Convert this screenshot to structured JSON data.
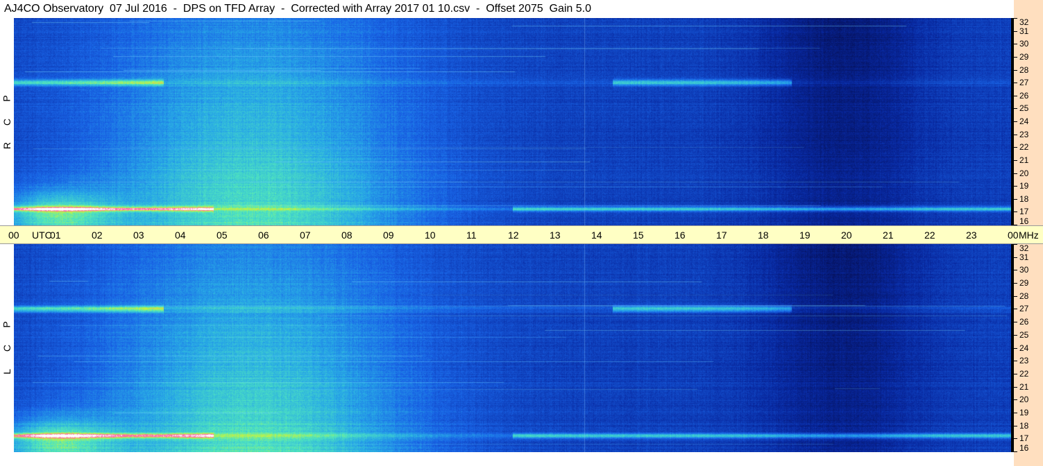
{
  "header": {
    "title": "AJ4CO Observatory  07 Jul 2016  -  DPS on TFD Array  -  Corrected with Array 2017 01 10.csv  -  Offset 2075  Gain 5.0"
  },
  "panels": [
    {
      "id": "rcp",
      "polarization_letters": [
        "R",
        "C",
        "P"
      ]
    },
    {
      "id": "lcp",
      "polarization_letters": [
        "L",
        "C",
        "P"
      ]
    }
  ],
  "frequency_axis": {
    "unit": "MHz",
    "labels": [
      "32",
      "31",
      "30",
      "29",
      "28",
      "27",
      "26",
      "25",
      "24",
      "23",
      "22",
      "21",
      "20",
      "19",
      "18",
      "17",
      "16"
    ]
  },
  "time_axis": {
    "unit": "UTC",
    "labels": [
      "00",
      "01",
      "02",
      "03",
      "04",
      "05",
      "06",
      "07",
      "08",
      "09",
      "10",
      "11",
      "12",
      "13",
      "14",
      "15",
      "16",
      "17",
      "18",
      "19",
      "20",
      "21",
      "22",
      "23",
      "00"
    ]
  },
  "colors": {
    "right_strip": "#ffdfbf",
    "time_axis_bg": "#ffffc4",
    "spectrogram_dark": "#05208a",
    "spectrogram_mid": "#1a5fe0",
    "spectrogram_bright": "#3fd6d0"
  }
}
